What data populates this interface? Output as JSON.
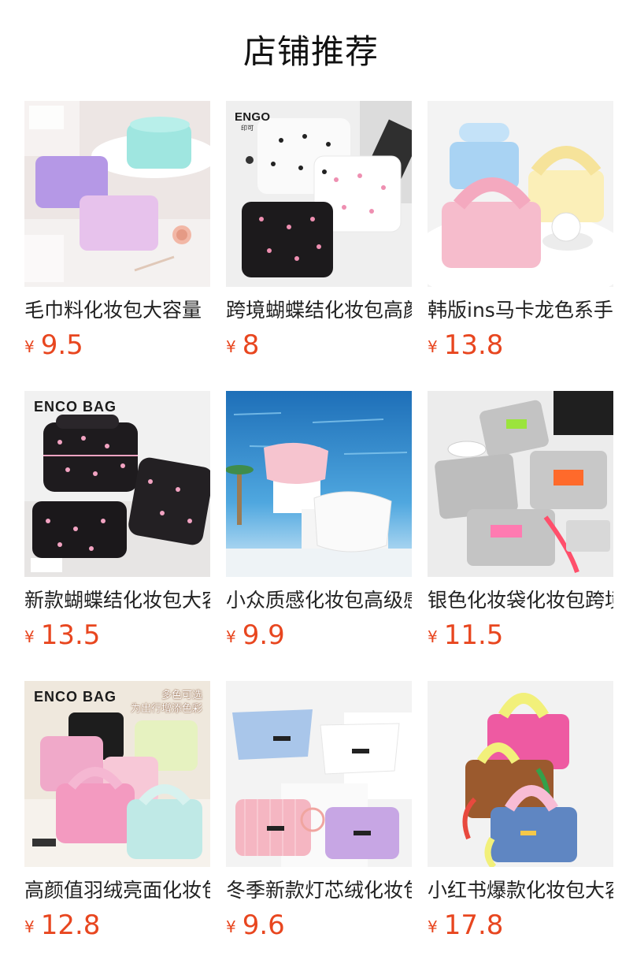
{
  "section": {
    "title": "店铺推荐"
  },
  "products": [
    {
      "name": "毛巾料化妆包大容量",
      "currency": "¥",
      "price": "9.5"
    },
    {
      "name": "跨境蝴蝶结化妆包高颜",
      "currency": "¥",
      "price": "8",
      "brand": "ENGO",
      "brand_sub": "印可"
    },
    {
      "name": "韩版ins马卡龙色系手",
      "currency": "¥",
      "price": "13.8"
    },
    {
      "name": "新款蝴蝶结化妆包大容",
      "currency": "¥",
      "price": "13.5",
      "brand": "ENCO BAG"
    },
    {
      "name": "小众质感化妆包高级感",
      "currency": "¥",
      "price": "9.9"
    },
    {
      "name": "银色化妆袋化妆包跨境",
      "currency": "¥",
      "price": "11.5"
    },
    {
      "name": "高颜值羽绒亮面化妆包",
      "currency": "¥",
      "price": "12.8",
      "brand": "ENCO BAG",
      "promo_line1": "多色可选",
      "promo_line2": "为出行增添色彩"
    },
    {
      "name": "冬季新款灯芯绒化妆包",
      "currency": "¥",
      "price": "9.6"
    },
    {
      "name": "小红书爆款化妆包大容",
      "currency": "¥",
      "price": "17.8"
    }
  ],
  "colors": {
    "price": "#e8461f",
    "title": "#111111",
    "name": "#222222"
  }
}
